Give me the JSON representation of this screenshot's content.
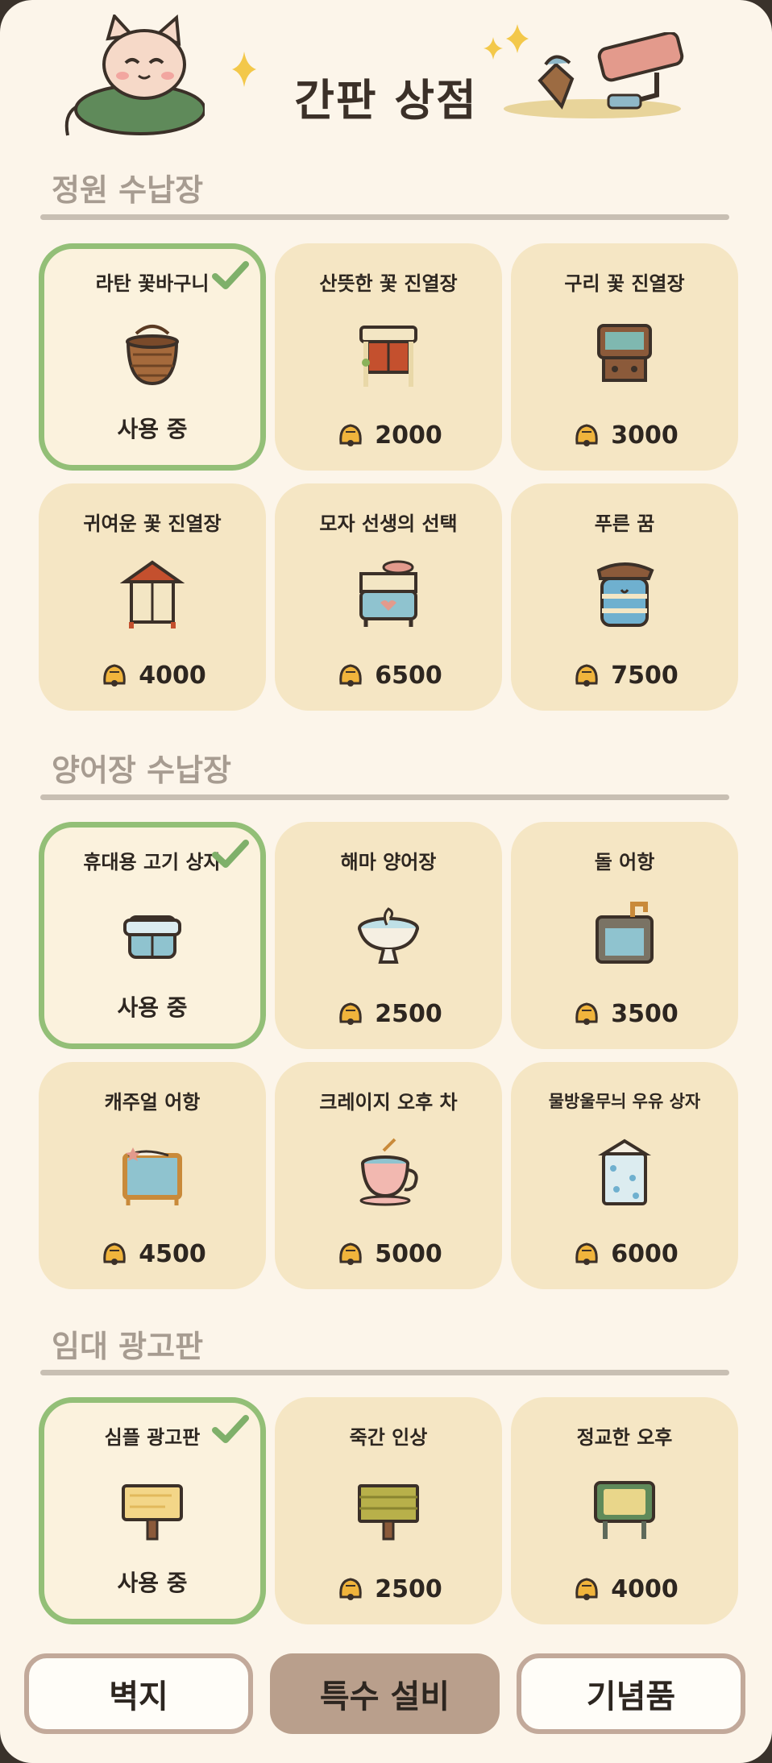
{
  "header": {
    "title": "간판 상점"
  },
  "sections": [
    {
      "title": "정원 수납장",
      "items": [
        {
          "name": "라탄 꽃바구니",
          "active": true,
          "status": "사용 중",
          "icon": "basket-icon"
        },
        {
          "name": "산뜻한 꽃 진열장",
          "price": "2000",
          "icon": "flower-stand-icon"
        },
        {
          "name": "구리 꽃 진열장",
          "price": "3000",
          "icon": "copper-stand-icon"
        },
        {
          "name": "귀여운 꽃 진열장",
          "price": "4000",
          "icon": "cute-stand-icon"
        },
        {
          "name": "모자 선생의 선택",
          "price": "6500",
          "icon": "hat-drawer-icon"
        },
        {
          "name": "푸른 꿈",
          "price": "7500",
          "icon": "blue-drawer-icon"
        }
      ]
    },
    {
      "title": "양어장 수납장",
      "items": [
        {
          "name": "휴대용 고기 상자",
          "active": true,
          "status": "사용 중",
          "icon": "fish-box-icon"
        },
        {
          "name": "해마 양어장",
          "price": "2500",
          "icon": "seahorse-bowl-icon"
        },
        {
          "name": "돌 어항",
          "price": "3500",
          "icon": "stone-tank-icon"
        },
        {
          "name": "캐주얼 어항",
          "price": "4500",
          "icon": "casual-tank-icon"
        },
        {
          "name": "크레이지 오후 차",
          "price": "5000",
          "icon": "teacup-icon"
        },
        {
          "name": "물방울무늬 우유 상자",
          "price": "6000",
          "icon": "milk-carton-icon"
        }
      ]
    },
    {
      "title": "임대 광고판",
      "items": [
        {
          "name": "심플 광고판",
          "active": true,
          "status": "사용 중",
          "icon": "simple-sign-icon"
        },
        {
          "name": "죽간 인상",
          "price": "2500",
          "icon": "bamboo-sign-icon"
        },
        {
          "name": "정교한 오후",
          "price": "4000",
          "icon": "framed-sign-icon"
        }
      ]
    }
  ],
  "tabs": [
    {
      "label": "벽지",
      "selected": false
    },
    {
      "label": "특수 설비",
      "selected": true
    },
    {
      "label": "기념품",
      "selected": false
    }
  ],
  "colors": {
    "background": "#fcf5ea",
    "card": "#f5e6c4",
    "active_border": "#93bf77",
    "section_title": "#a79c91",
    "tab_selected": "#b99f8c",
    "tab_outline": "#c2a99a"
  }
}
